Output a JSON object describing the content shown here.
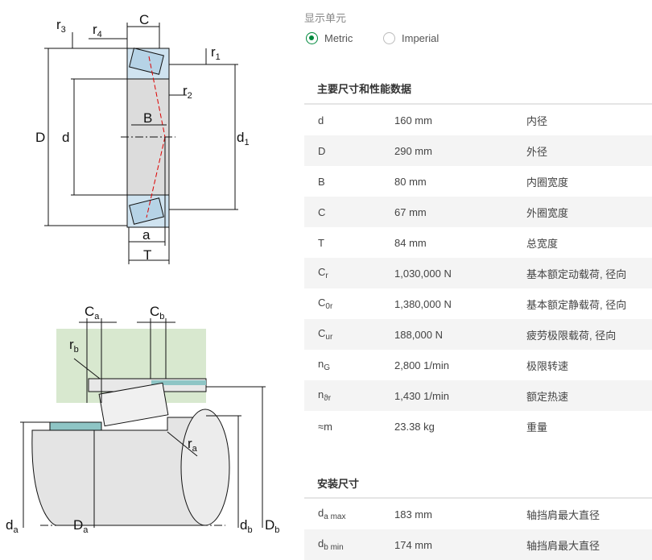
{
  "diagram_labels": {
    "r3": "r",
    "r3_sub": "3",
    "r4": "r",
    "r4_sub": "4",
    "C": "C",
    "r1": "r",
    "r1_sub": "1",
    "r2": "r",
    "r2_sub": "2",
    "D": "D",
    "d": "d",
    "B": "B",
    "d1": "d",
    "d1_sub": "1",
    "a": "a",
    "T": "T",
    "Ca": "C",
    "Ca_sub": "a",
    "Cb": "C",
    "Cb_sub": "b",
    "rb": "r",
    "rb_sub": "b",
    "ra": "r",
    "ra_sub": "a",
    "da": "d",
    "da_sub": "a",
    "Da": "D",
    "Da_sub": "a",
    "db": "d",
    "db_sub": "b",
    "Db": "D",
    "Db_sub": "b"
  },
  "units": {
    "title": "显示单元",
    "metric_label": "Metric",
    "imperial_label": "Imperial",
    "selected": "Metric",
    "accent_color": "#00893d"
  },
  "main_section": {
    "title": "主要尺寸和性能数据",
    "rows": [
      {
        "symbol": "d",
        "sub": "",
        "value": "160 mm",
        "desc": "内径"
      },
      {
        "symbol": "D",
        "sub": "",
        "value": "290 mm",
        "desc": "外径"
      },
      {
        "symbol": "B",
        "sub": "",
        "value": "80 mm",
        "desc": "内圈宽度"
      },
      {
        "symbol": "C",
        "sub": "",
        "value": "67 mm",
        "desc": "外圈宽度"
      },
      {
        "symbol": "T",
        "sub": "",
        "value": "84 mm",
        "desc": "总宽度"
      },
      {
        "symbol": "C",
        "sub": "r",
        "value": "1,030,000 N",
        "desc": "基本额定动载荷, 径向"
      },
      {
        "symbol": "C",
        "sub": "0r",
        "value": "1,380,000 N",
        "desc": "基本额定静载荷, 径向"
      },
      {
        "symbol": "C",
        "sub": "ur",
        "value": "188,000 N",
        "desc": "疲劳极限载荷, 径向"
      },
      {
        "symbol": "n",
        "sub": "G",
        "value": "2,800 1/min",
        "desc": "极限转速"
      },
      {
        "symbol": "n",
        "sub": "ϑr",
        "value": "1,430 1/min",
        "desc": "额定热速"
      },
      {
        "symbol": "≈m",
        "sub": "",
        "value": "23.38 kg",
        "desc": "重量"
      }
    ]
  },
  "mount_section": {
    "title": "安装尺寸",
    "rows": [
      {
        "symbol": "d",
        "sub": "a max",
        "value": "183 mm",
        "desc": "轴挡肩最大直径"
      },
      {
        "symbol": "d",
        "sub": "b min",
        "value": "174 mm",
        "desc": "轴挡肩最大直径"
      }
    ]
  }
}
